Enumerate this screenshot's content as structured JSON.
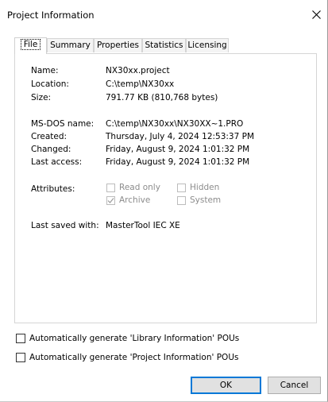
{
  "window": {
    "title": "Project Information"
  },
  "tabs": [
    {
      "label": "File",
      "active": true
    },
    {
      "label": "Summary"
    },
    {
      "label": "Properties"
    },
    {
      "label": "Statistics"
    },
    {
      "label": "Licensing"
    }
  ],
  "file": {
    "name_label": "Name:",
    "name_value": "NX30xx.project",
    "location_label": "Location:",
    "location_value": "C:\\temp\\NX30xx",
    "size_label": "Size:",
    "size_value": "791.77 KB (810,768 bytes)",
    "msdos_label": "MS-DOS name:",
    "msdos_value": "C:\\temp\\NX30xx\\NX30XX~1.PRO",
    "created_label": "Created:",
    "created_value": "Thursday, July 4, 2024 12:53:37 PM",
    "changed_label": "Changed:",
    "changed_value": "Friday, August 9, 2024 1:01:32 PM",
    "last_access_label": "Last access:",
    "last_access_value": "Friday, August 9, 2024 1:01:32 PM",
    "attributes_label": "Attributes:",
    "attributes": {
      "read_only": {
        "label": "Read only",
        "checked": false
      },
      "hidden": {
        "label": "Hidden",
        "checked": false
      },
      "archive": {
        "label": "Archive",
        "checked": true
      },
      "system": {
        "label": "System",
        "checked": false
      }
    },
    "last_saved_label": "Last saved with:",
    "last_saved_value": "MasterTool IEC XE"
  },
  "options": {
    "library_label": "Automatically generate 'Library Information' POUs",
    "library_checked": false,
    "project_label": "Automatically generate 'Project Information' POUs",
    "project_checked": false
  },
  "buttons": {
    "ok": "OK",
    "cancel": "Cancel"
  },
  "colors": {
    "accent": "#0078d7",
    "disabled_text": "#8c8c8c",
    "button_face": "#e1e1e1"
  }
}
